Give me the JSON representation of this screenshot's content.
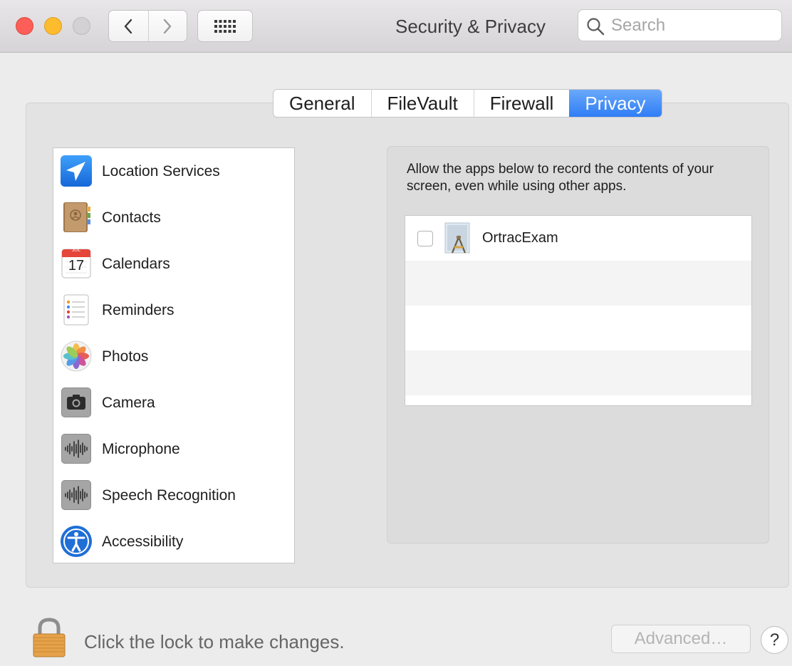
{
  "window": {
    "title": "Security & Privacy"
  },
  "toolbar": {
    "search_placeholder": "Search"
  },
  "tabs": [
    {
      "label": "General",
      "active": false
    },
    {
      "label": "FileVault",
      "active": false
    },
    {
      "label": "Firewall",
      "active": false
    },
    {
      "label": "Privacy",
      "active": true
    }
  ],
  "sidebar": {
    "items": [
      {
        "label": "Location Services",
        "icon": "location-services-icon"
      },
      {
        "label": "Contacts",
        "icon": "contacts-icon"
      },
      {
        "label": "Calendars",
        "icon": "calendar-icon"
      },
      {
        "label": "Reminders",
        "icon": "reminders-icon"
      },
      {
        "label": "Photos",
        "icon": "photos-icon"
      },
      {
        "label": "Camera",
        "icon": "camera-icon"
      },
      {
        "label": "Microphone",
        "icon": "microphone-icon"
      },
      {
        "label": "Speech Recognition",
        "icon": "speech-recognition-icon"
      },
      {
        "label": "Accessibility",
        "icon": "accessibility-icon"
      }
    ],
    "calendar_icon": {
      "month": "JUL",
      "day": "17"
    }
  },
  "detail": {
    "description": "Allow the apps below to record the contents of your screen, even while using other apps.",
    "apps": [
      {
        "name": "OrtracExam",
        "checked": false,
        "icon": "app-generic-icon"
      }
    ]
  },
  "footer": {
    "lock_text": "Click the lock to make changes.",
    "advanced_label": "Advanced…",
    "help_label": "?"
  },
  "colors": {
    "accent": "#2f7df5",
    "close": "#fc5f57",
    "minimize": "#fdbc2e",
    "zoom_disabled": "#d3d1d3"
  }
}
